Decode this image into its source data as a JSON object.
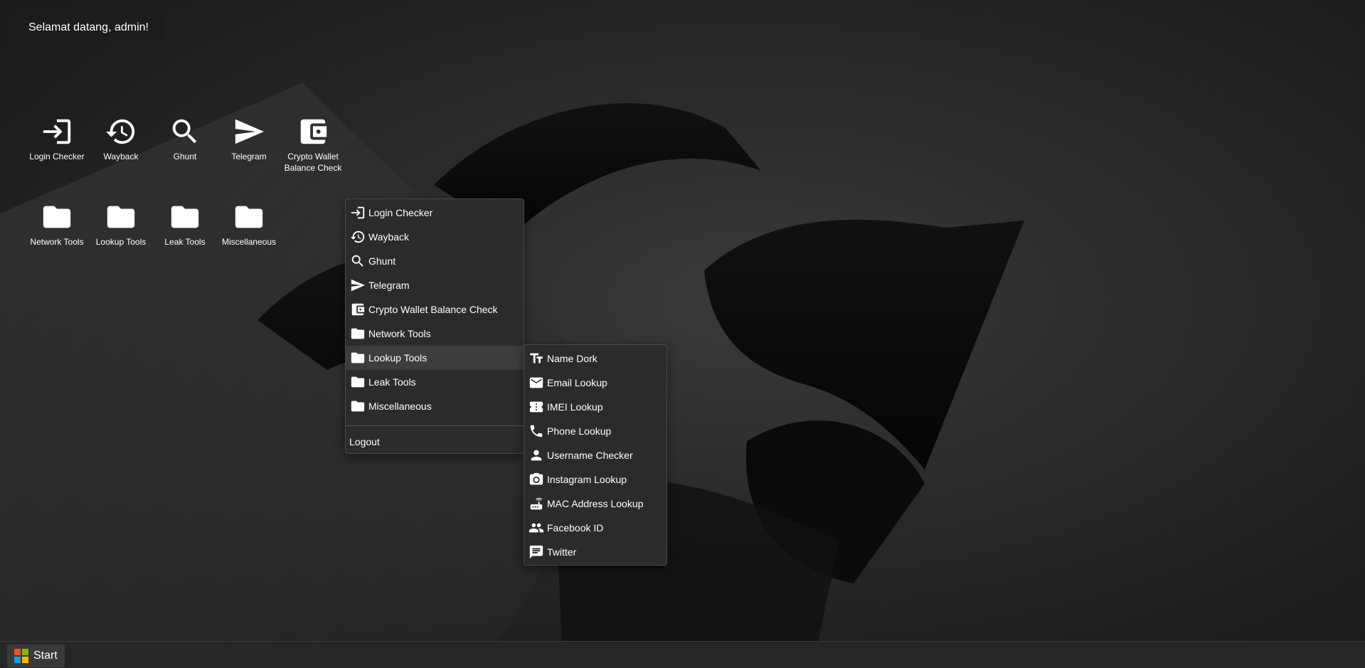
{
  "greeting": "Selamat datang, admin!",
  "desktop_icons": [
    {
      "label": "Login Checker",
      "icon": "login-icon"
    },
    {
      "label": "Wayback",
      "icon": "history-icon"
    },
    {
      "label": "Ghunt",
      "icon": "search-icon"
    },
    {
      "label": "Telegram",
      "icon": "send-icon"
    },
    {
      "label": "Crypto Wallet Balance Check",
      "icon": "wallet-icon"
    },
    {
      "label": "Network Tools",
      "icon": "folder-icon"
    },
    {
      "label": "Lookup Tools",
      "icon": "folder-icon"
    },
    {
      "label": "Leak Tools",
      "icon": "folder-icon"
    },
    {
      "label": "Miscellaneous",
      "icon": "folder-icon"
    }
  ],
  "context_menu": {
    "items": [
      {
        "label": "Login Checker",
        "icon": "login-icon"
      },
      {
        "label": "Wayback",
        "icon": "history-icon"
      },
      {
        "label": "Ghunt",
        "icon": "search-icon"
      },
      {
        "label": "Telegram",
        "icon": "send-icon"
      },
      {
        "label": "Crypto Wallet Balance Check",
        "icon": "wallet-icon"
      },
      {
        "label": "Network Tools",
        "icon": "folder-icon"
      },
      {
        "label": "Lookup Tools",
        "icon": "folder-icon"
      },
      {
        "label": "Leak Tools",
        "icon": "folder-icon"
      },
      {
        "label": "Miscellaneous",
        "icon": "folder-icon"
      }
    ],
    "logout_label": "Logout"
  },
  "submenu": {
    "items": [
      {
        "label": "Name Dork",
        "icon": "text-fields-icon"
      },
      {
        "label": "Email Lookup",
        "icon": "email-icon"
      },
      {
        "label": "IMEI Lookup",
        "icon": "sim-card-icon"
      },
      {
        "label": "Phone Lookup",
        "icon": "phone-icon"
      },
      {
        "label": "Username Checker",
        "icon": "person-icon"
      },
      {
        "label": "Instagram Lookup",
        "icon": "camera-icon"
      },
      {
        "label": "MAC Address Lookup",
        "icon": "router-icon"
      },
      {
        "label": "Facebook ID",
        "icon": "people-icon"
      },
      {
        "label": "Twitter",
        "icon": "chat-icon"
      }
    ]
  },
  "taskbar": {
    "start_label": "Start",
    "logo_colors": [
      "#f25022",
      "#7fba00",
      "#00a4ef",
      "#ffb900"
    ]
  }
}
